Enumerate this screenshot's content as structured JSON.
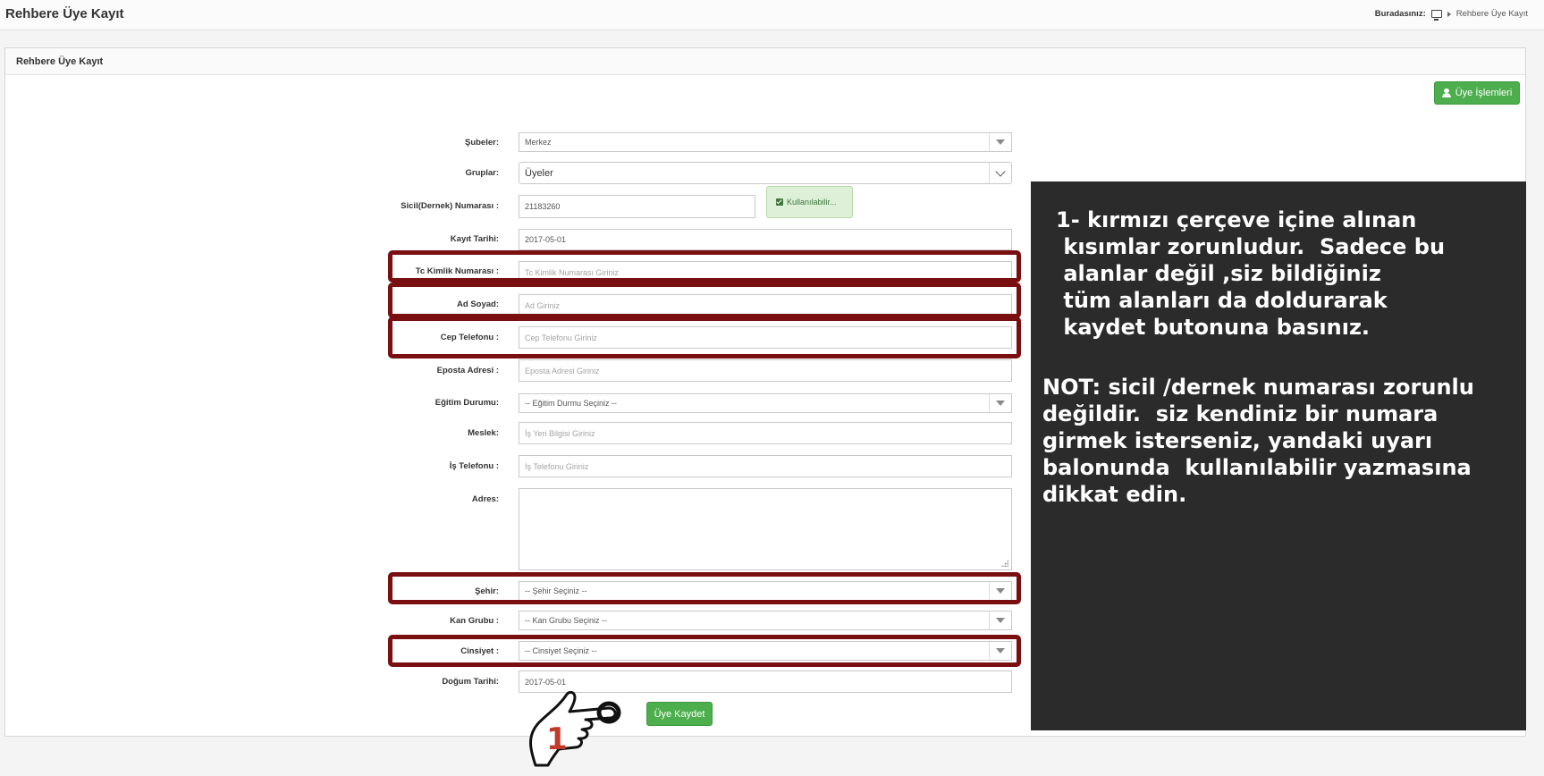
{
  "header": {
    "title": "Rehbere Üye Kayıt",
    "breadcrumb_label": "Buradasınız:",
    "breadcrumb_current": "Rehbere Üye Kayıt"
  },
  "panel": {
    "title": "Rehbere Üye Kayıt",
    "member_ops_button": "Üye İşlemleri"
  },
  "form": {
    "subeler": {
      "label": "Şubeler:",
      "value": "Merkez"
    },
    "gruplar": {
      "label": "Gruplar:",
      "value": "Üyeler"
    },
    "sicil": {
      "label": "Sicil(Dernek) Numarası :",
      "value": "21183260",
      "status": "Kullanılabilir..."
    },
    "kayit_tarihi": {
      "label": "Kayıt Tarihi:",
      "value": "2017-05-01"
    },
    "tc": {
      "label": "Tc Kimlik Numarası :",
      "placeholder": "Tc Kimlik Numarası Giriniz"
    },
    "ad_soyad": {
      "label": "Ad Soyad:",
      "placeholder": "Ad Giriniz"
    },
    "cep": {
      "label": "Cep Telefonu :",
      "placeholder": "Cep Telefonu Giriniz"
    },
    "eposta": {
      "label": "Eposta Adresi :",
      "placeholder": "Eposta Adresi Giriniz"
    },
    "egitim": {
      "label": "Eğitim Durumu:",
      "value": "-- Eğitim Durmu Seçiniz --"
    },
    "meslek": {
      "label": "Meslek:",
      "placeholder": "İş Yeri Bilgisi Giriniz"
    },
    "is_tel": {
      "label": "İş Telefonu :",
      "placeholder": "İş Telefonu Giriniz"
    },
    "adres": {
      "label": "Adres:",
      "value": ""
    },
    "sehir": {
      "label": "Şehir:",
      "value": "-- Şehir Seçiniz --"
    },
    "kan": {
      "label": "Kan Grubu :",
      "value": "-- Kan Grubu Seçiniz --"
    },
    "cinsiyet": {
      "label": "Cinsiyet :",
      "value": "-- Cinsiyet Seçiniz --"
    },
    "dogum": {
      "label": "Doğum Tarihi:",
      "value": "2017-05-01"
    },
    "submit_label": "Üye Kaydet"
  },
  "annotation": {
    "note_1": "1- kırmızı çerçeve içine alınan\n kısımlar zorunludur.  Sadece bu\n alanlar değil ,siz bildiğiniz\n tüm alanları da doldurarak\n kaydet butonuna basınız.",
    "note_2": "NOT: sicil /dernek numarası zorunlu\ndeğildir.  siz kendiniz bir numara\ngirmek isterseniz, yandaki uyarı\nbalonunda  kullanılabilir yazmasına\ndikkat edin.",
    "hand_number": "1",
    "frame_color": "#7a0f12",
    "number_color": "#c0392b"
  },
  "colors": {
    "success": "#4cae4c",
    "note_background": "#2b2b2b"
  }
}
